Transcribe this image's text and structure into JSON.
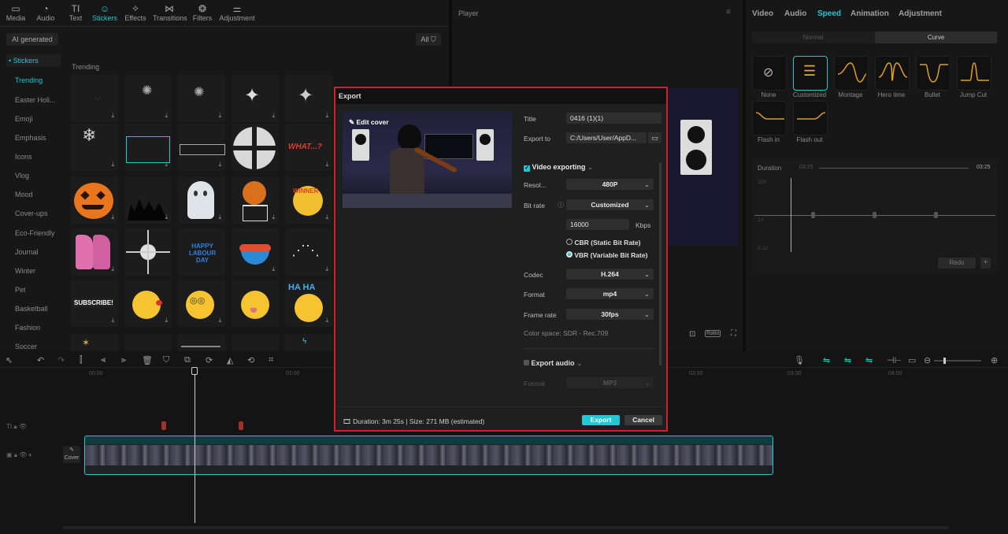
{
  "toolbar": {
    "tabs": [
      {
        "label": "Media",
        "icon": "media-icon"
      },
      {
        "label": "Audio",
        "icon": "audio-icon"
      },
      {
        "label": "Text",
        "icon": "text-icon"
      },
      {
        "label": "Stickers",
        "icon": "stickers-icon"
      },
      {
        "label": "Effects",
        "icon": "effects-icon"
      },
      {
        "label": "Transitions",
        "icon": "transitions-icon"
      },
      {
        "label": "Filters",
        "icon": "filters-icon"
      },
      {
        "label": "Adjustment",
        "icon": "adjustment-icon"
      }
    ],
    "active": "Stickers"
  },
  "sidebar": {
    "ai_generated": "AI generated",
    "stickers_label": "• Stickers",
    "items": [
      "Trending",
      "Easter Holi...",
      "Emoji",
      "Emphasis",
      "Icons",
      "Vlog",
      "Mood",
      "Cover-ups",
      "Eco-Friendly",
      "Journal",
      "Winter",
      "Pet",
      "Basketball",
      "Fashion",
      "Soccer"
    ]
  },
  "stickers": {
    "section": "Trending",
    "filter_label": "All"
  },
  "sticker_text": {
    "what": "WHAT...?",
    "winner": "WINNER",
    "labour": "HAPPY LABOUR DAY",
    "subscribe": "SUBSCRIBE!",
    "haha": "HA HA"
  },
  "player": {
    "title": "Player",
    "ratio": "Ratio"
  },
  "right_panel": {
    "tabs": [
      "Video",
      "Audio",
      "Speed",
      "Animation",
      "Adjustment"
    ],
    "active": "Speed",
    "subtabs": [
      "Normal",
      "Curve"
    ],
    "curves": [
      "None",
      "Customized",
      "Montage",
      "Hero time",
      "Bullet",
      "Jump Cut",
      "Flash in",
      "Flash out"
    ],
    "duration_label": "Duration",
    "duration_start": "03:25",
    "duration_end": "03:25",
    "y_labels": [
      "10x",
      "1x",
      "0.1x"
    ],
    "redo": "Redo",
    "add": "+"
  },
  "timeline": {
    "ticks": [
      "00:00",
      "01:00",
      "03:00",
      "03:30",
      "04:00"
    ],
    "cover_label": "Cover"
  },
  "export": {
    "title": "Export",
    "edit_cover": "Edit cover",
    "fields": {
      "title_label": "Title",
      "title_value": "0416 (1)(1)",
      "export_to_label": "Export to",
      "export_to_value": "C:/Users/User/AppD..."
    },
    "video_exporting": "Video exporting",
    "resolution_label": "Resol...",
    "resolution_value": "480P",
    "bitrate_label": "Bit rate",
    "bitrate_value": "Customized",
    "kbps_value": "16000",
    "kbps_unit": "Kbps",
    "cbr": "CBR (Static Bit Rate)",
    "vbr": "VBR (Variable Bit Rate)",
    "codec_label": "Codec",
    "codec_value": "H.264",
    "format_label": "Format",
    "format_value": "mp4",
    "framerate_label": "Frame rate",
    "framerate_value": "30fps",
    "color_space": "Color space: SDR - Rec.709",
    "export_audio": "Export audio",
    "audio_format_label": "Format",
    "audio_format_value": "MP3",
    "duration_info": "Duration: 3m 25s | Size: 271 MB (estimated)",
    "export_button": "Export",
    "cancel_button": "Cancel",
    "accent": "#1fc8d2",
    "border": "#d0212b"
  }
}
